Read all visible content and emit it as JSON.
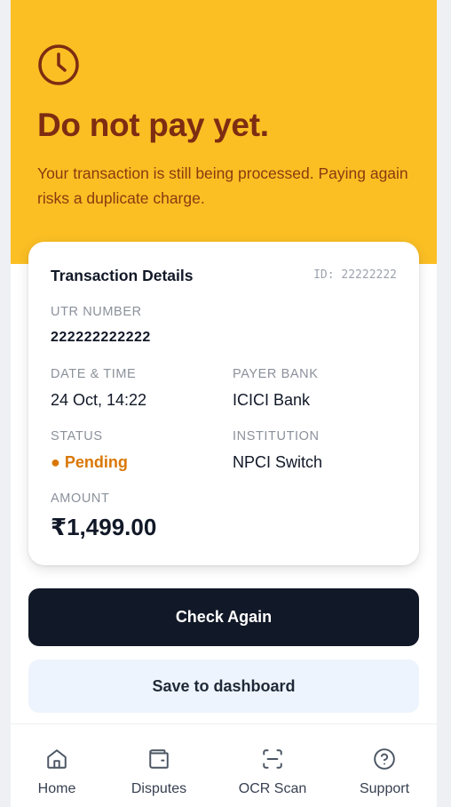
{
  "hero": {
    "icon": "clock-icon",
    "title": "Do not pay yet.",
    "subtitle": "Your transaction is still being processed. Paying again risks a duplicate charge.",
    "background_color": "#fbbf24",
    "text_color": "#7c2d12"
  },
  "card": {
    "title": "Transaction Details",
    "id_text": "ID: 22222222",
    "utr": {
      "label": "UTR NUMBER",
      "value": "222222222222"
    },
    "datetime": {
      "label": "DATE & TIME",
      "value": "24 Oct, 14:22"
    },
    "payer_bank": {
      "label": "PAYER BANK",
      "value": "ICICI Bank"
    },
    "status": {
      "label": "STATUS",
      "value": "● Pending",
      "color": "#d97706"
    },
    "institution": {
      "label": "INSTITUTION",
      "value": "NPCI Switch"
    },
    "amount": {
      "label": "AMOUNT",
      "value": "₹1,499.00"
    }
  },
  "actions": {
    "primary": "Check Again",
    "secondary": "Save to dashboard"
  },
  "nav": [
    {
      "label": "Home",
      "icon": "home-icon"
    },
    {
      "label": "Disputes",
      "icon": "wallet-icon"
    },
    {
      "label": "OCR Scan",
      "icon": "scan-icon"
    },
    {
      "label": "Support",
      "icon": "help-circle-icon"
    }
  ]
}
